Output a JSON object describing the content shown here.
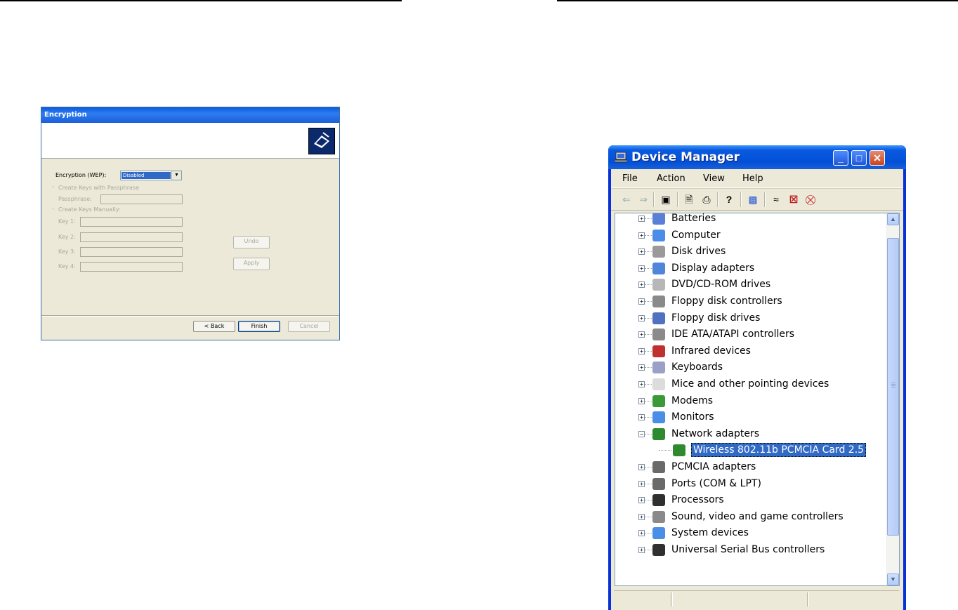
{
  "encryption_dialog": {
    "title": "Encryption",
    "encryption_label": "Encryption (WEP):",
    "encryption_value": "Disabled",
    "option_passphrase": "Create Keys with Passphrase",
    "passphrase_label": "Passphrase:",
    "option_manual": "Create Keys Manually:",
    "key1_label": "Key 1:",
    "key2_label": "Key 2:",
    "key3_label": "Key 3:",
    "key4_label": "Key 4:",
    "undo_label": "Undo",
    "apply_label": "Apply",
    "back_label": "< Back",
    "finish_label": "Finish",
    "cancel_label": "Cancel"
  },
  "device_manager": {
    "title": "Device Manager",
    "menu": {
      "file": "File",
      "action": "Action",
      "view": "View",
      "help": "Help"
    },
    "tree": [
      {
        "label": "Batteries",
        "icon": "battery-icon",
        "color": "#5a7fd6"
      },
      {
        "label": "Computer",
        "icon": "computer-icon",
        "color": "#4b8ee8"
      },
      {
        "label": "Disk drives",
        "icon": "disk-drive-icon",
        "color": "#9a9a9a"
      },
      {
        "label": "Display adapters",
        "icon": "display-adapter-icon",
        "color": "#4f86d9"
      },
      {
        "label": "DVD/CD-ROM drives",
        "icon": "dvd-drive-icon",
        "color": "#b7b7b7"
      },
      {
        "label": "Floppy disk controllers",
        "icon": "floppy-controller-icon",
        "color": "#8a8a8a"
      },
      {
        "label": "Floppy disk drives",
        "icon": "floppy-drive-icon",
        "color": "#5070c0"
      },
      {
        "label": "IDE ATA/ATAPI controllers",
        "icon": "ide-controller-icon",
        "color": "#8a8a8a"
      },
      {
        "label": "Infrared devices",
        "icon": "infrared-icon",
        "color": "#c03030"
      },
      {
        "label": "Keyboards",
        "icon": "keyboard-icon",
        "color": "#9aa0c8"
      },
      {
        "label": "Mice and other pointing devices",
        "icon": "mouse-icon",
        "color": "#dcdcdc"
      },
      {
        "label": "Modems",
        "icon": "modem-icon",
        "color": "#3a9a3a"
      },
      {
        "label": "Monitors",
        "icon": "monitor-icon",
        "color": "#4b8ee8"
      },
      {
        "label": "Network adapters",
        "icon": "network-adapter-icon",
        "color": "#2f8a2f",
        "expanded": true
      },
      {
        "label": "PCMCIA adapters",
        "icon": "pcmcia-icon",
        "color": "#6a6a6a"
      },
      {
        "label": "Ports (COM & LPT)",
        "icon": "port-icon",
        "color": "#6a6a6a"
      },
      {
        "label": "Processors",
        "icon": "processor-icon",
        "color": "#303030"
      },
      {
        "label": "Sound, video and game controllers",
        "icon": "sound-icon",
        "color": "#8a8a8a"
      },
      {
        "label": "System devices",
        "icon": "system-device-icon",
        "color": "#4b8ee8"
      },
      {
        "label": "Universal Serial Bus controllers",
        "icon": "usb-icon",
        "color": "#303030"
      }
    ],
    "selected_child": "Wireless 802.11b PCMCIA Card 2.5"
  }
}
